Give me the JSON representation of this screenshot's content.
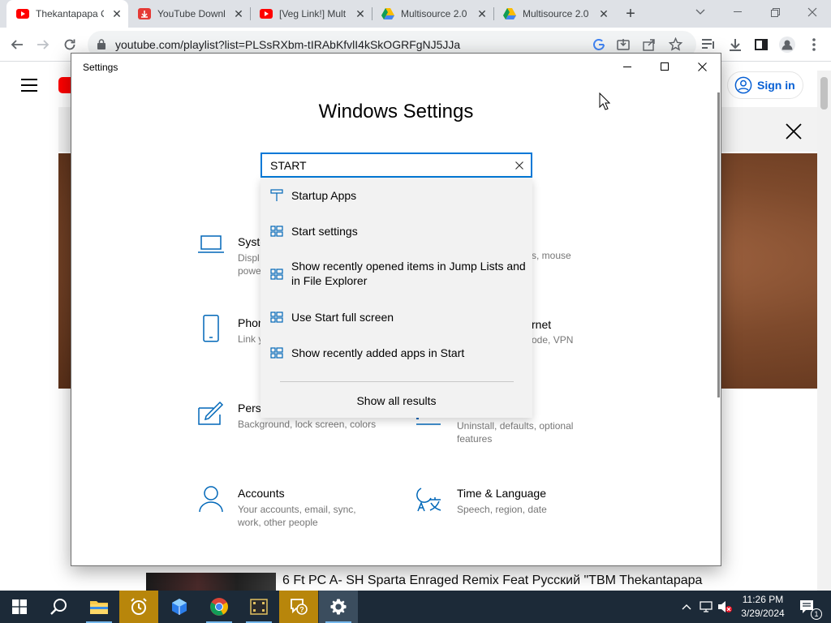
{
  "browser": {
    "tabs": [
      {
        "title": "Thekantapapa O",
        "favicon": "youtube-icon",
        "active": true
      },
      {
        "title": "YouTube Downl",
        "favicon": "download-icon",
        "active": false
      },
      {
        "title": "[Veg Link!] Mult",
        "favicon": "youtube-icon",
        "active": false
      },
      {
        "title": "Multisource 2.0",
        "favicon": "google-drive-icon",
        "active": false
      },
      {
        "title": "Multisource 2.0",
        "favicon": "google-drive-icon",
        "active": false
      }
    ],
    "url": "youtube.com/playlist?list=PLSsRXbm-tIRAbKfvlI4kSkOGRFgNJ5JJa"
  },
  "youtube": {
    "signin_label": "Sign in",
    "video_title": "6 Ft PC A- SH Sparta Enraged Remix Feat Русский \"TBM Thekantapapa"
  },
  "settings_window": {
    "title": "Settings",
    "heading": "Windows Settings",
    "search_value": "START",
    "categories": [
      {
        "name": "Syste",
        "desc": "Displ\npowe",
        "icon": "laptop-icon"
      },
      {
        "name": "Phon",
        "desc": "Link y",
        "icon": "phone-icon"
      },
      {
        "name": "Perso",
        "desc": "Background, lock screen, colors",
        "icon": "personalization-icon"
      },
      {
        "name": "Accounts",
        "desc": "Your accounts, email, sync, work, other people",
        "icon": "person-icon"
      },
      {
        "name": "Time & Language",
        "desc": "Speech, region, date",
        "icon": "time-language-icon"
      }
    ],
    "partial_texts": {
      "devices_desc": "s, mouse",
      "network_name": "rnet",
      "network_desc": "ode, VPN",
      "apps_desc": "Uninstall, defaults, optional features"
    },
    "search_results": [
      {
        "label": "Startup Apps",
        "icon": "pin-icon"
      },
      {
        "label": "Start settings",
        "icon": "start-menu-icon"
      },
      {
        "label": "Show recently opened items in Jump Lists and in File Explorer",
        "icon": "start-menu-icon"
      },
      {
        "label": "Use Start full screen",
        "icon": "start-menu-icon"
      },
      {
        "label": "Show recently added apps in Start",
        "icon": "start-menu-icon"
      }
    ],
    "show_all_label": "Show all results"
  },
  "taskbar": {
    "apps": [
      "start-icon",
      "search-icon",
      "file-explorer-icon",
      "alarm-clock-icon",
      "app-icon",
      "chrome-icon",
      "video-editor-icon",
      "help-icon",
      "settings-icon"
    ],
    "time": "11:26 PM",
    "date": "3/29/2024",
    "notification_count": "1"
  },
  "colors": {
    "accent": "#0078d7",
    "taskbar": "#1c2a38",
    "youtube_red": "#ff0000",
    "link_blue": "#065fd4"
  }
}
